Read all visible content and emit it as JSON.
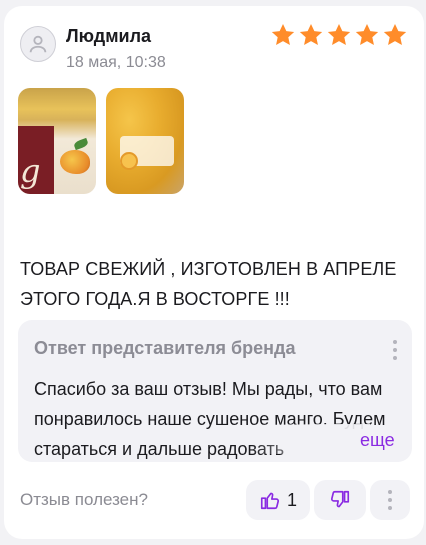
{
  "review": {
    "author": "Людмила",
    "date": "18 мая, 10:38",
    "rating": 5,
    "rating_max": 5,
    "star_color": "#ff8c2a",
    "photos": [
      "photo-package-front",
      "photo-dried-mango"
    ],
    "photo_overlay_text": "g",
    "text": "ТОВАР СВЕЖИЙ , ИЗГОТОВЛЕН В АПРЕЛЕ ЭТОГО ГОДА.Я В ВОСТОРГЕ !!!"
  },
  "reply": {
    "title": "Ответ представителя бренда",
    "body": "Спасибо за ваш отзыв! Мы рады, что вам понравилось наше сушеное манго. Будем стараться и дальше радовать",
    "more_label": "еще",
    "accent_color": "#8a2be2"
  },
  "footer": {
    "helpful_label": "Отзыв полезен?",
    "like_count": "1",
    "like_icon": "thumb-up-icon",
    "dislike_icon": "thumb-down-icon",
    "more_icon": "more-vertical-icon",
    "icon_color": "#8a2be2"
  }
}
